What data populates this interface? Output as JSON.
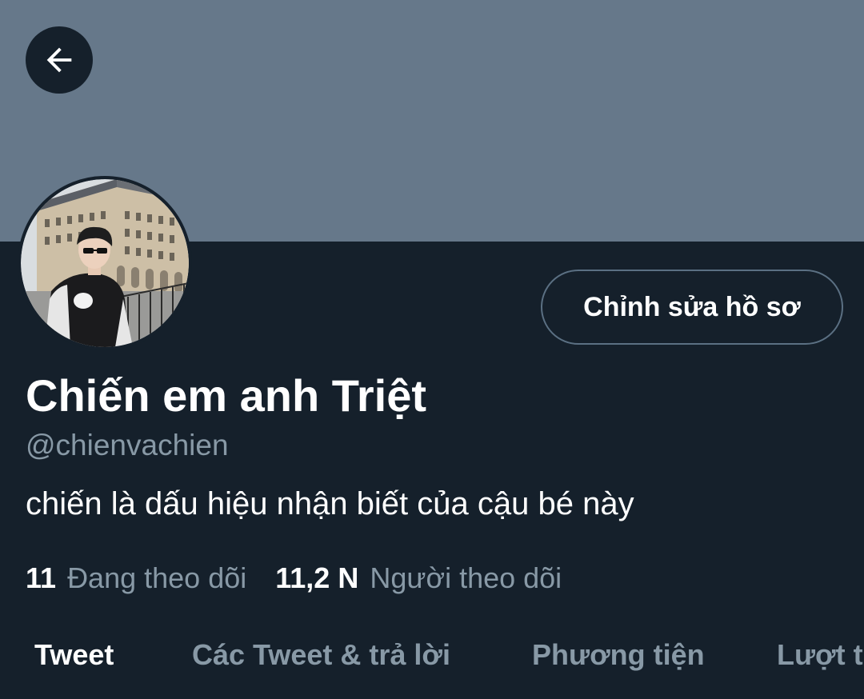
{
  "header": {
    "back_icon": "arrow-left-icon",
    "banner_color": "#66788a"
  },
  "profile": {
    "display_name": "Chiến em anh Triệt",
    "handle": "@chienvachien",
    "bio": "chiến là dấu hiệu nhận biết của cậu bé này",
    "edit_button_label": "Chỉnh sửa hồ sơ",
    "following_count": "11",
    "following_label": "Đang theo dõi",
    "followers_count": "11,2 N",
    "followers_label": "Người theo dõi"
  },
  "tabs": [
    {
      "label": "Tweet",
      "active": true
    },
    {
      "label": "Các Tweet & trả lời",
      "active": false
    },
    {
      "label": "Phương tiện",
      "active": false
    },
    {
      "label": "Lượt thích",
      "active": false
    }
  ],
  "colors": {
    "background": "#15202b",
    "secondary_text": "#8899a6",
    "primary_text": "#ffffff",
    "border": "#5b7083"
  }
}
